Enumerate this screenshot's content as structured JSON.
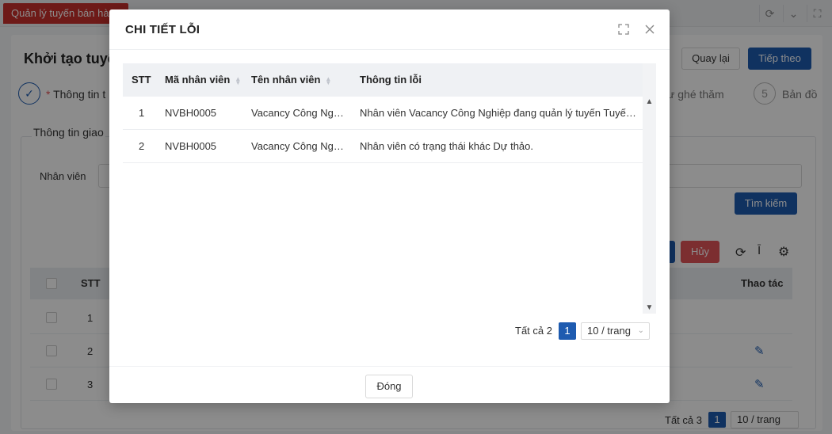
{
  "app_tab": "Quản lý tuyến bán hàng",
  "page": {
    "title": "Khởi tạo tuyế",
    "back_label": "Quay lại",
    "next_label": "Tiếp theo",
    "step1_label": "Thông tin t",
    "step1_required": "*",
    "step4_label": "ư ghé thăm",
    "step5_number": "5",
    "step5_label": "Bản đồ",
    "section_title": "Thông tin giao",
    "employee_label": "Nhân viên",
    "search_label": "Tìm kiếm",
    "cancel_label": "Hủy",
    "table_stt": "STT",
    "table_actions": "Thao tác",
    "rows": [
      "1",
      "2",
      "3"
    ],
    "pager_total": "Tất cả 3",
    "pager_page": "1",
    "pager_size": "10 / trang"
  },
  "modal": {
    "title": "CHI TIẾT LỖI",
    "columns": {
      "stt": "STT",
      "code": "Mã nhân viên",
      "name": "Tên nhân viên",
      "info": "Thông tin lỗi"
    },
    "rows": [
      {
        "stt": "1",
        "code": "NVBH0005",
        "name": "Vacancy Công Nghi...",
        "info": "Nhân viên Vacancy Công Nghiệp đang quản lý tuyến Tuyến 1..."
      },
      {
        "stt": "2",
        "code": "NVBH0005",
        "name": "Vacancy Công Nghi...",
        "info": "Nhân viên có trạng thái khác Dự thảo."
      }
    ],
    "pager_total": "Tất cả 2",
    "pager_page": "1",
    "pager_size": "10 / trang",
    "close_label": "Đóng"
  }
}
